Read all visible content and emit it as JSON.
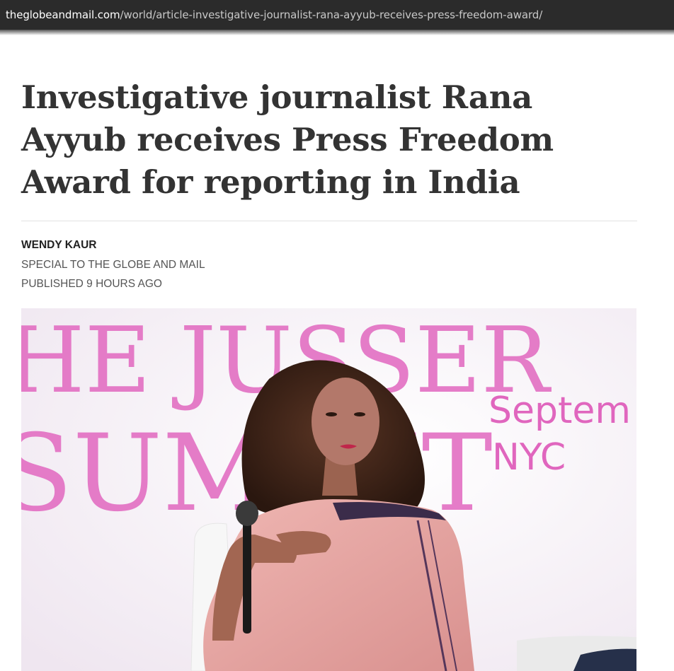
{
  "browser": {
    "url_domain": "theglobeandmail.com",
    "url_path": "/world/article-investigative-journalist-rana-ayyub-receives-press-freedom-award/"
  },
  "article": {
    "headline": "Investigative journalist Rana Ayyub receives Press Freedom Award for reporting in India",
    "author": "WENDY KAUR",
    "affiliation": "SPECIAL TO THE GLOBE AND MAIL",
    "published": "PUBLISHED 9 HOURS AGO"
  },
  "photo": {
    "backdrop_text": {
      "line1": "HE JUSSER",
      "line2": "SUMMIT",
      "date": "Septem",
      "city": "NYC"
    },
    "colors": {
      "backdrop": "#f4eef4",
      "brand_pink": "#e066be",
      "saree": "#e7a9a6",
      "hair": "#3a2418",
      "skin": "#a8705a"
    }
  }
}
